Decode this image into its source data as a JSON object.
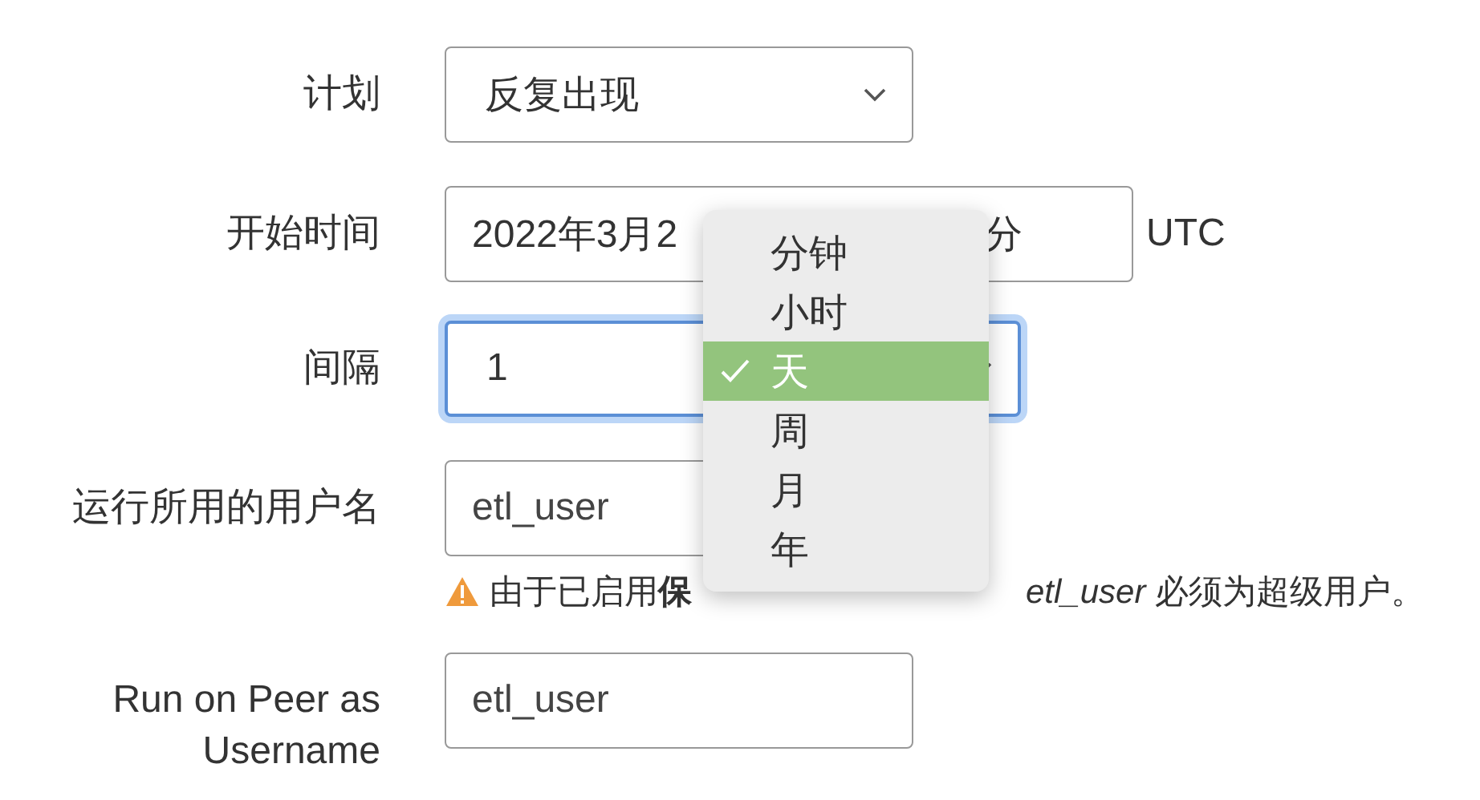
{
  "form": {
    "rows": [
      {
        "label": "计划",
        "kind": "select",
        "value": "反复出现",
        "focused": false
      },
      {
        "label": "开始时间",
        "kind": "datetime",
        "value": "2022年3月2",
        "value_end": "分",
        "suffix": "UTC"
      },
      {
        "label": "间隔",
        "kind": "select",
        "value": "1",
        "focused": true
      },
      {
        "label": "运行所用的用户名",
        "kind": "input",
        "value": "etl_user",
        "warning": {
          "before": "由于已启用**保**",
          "after": "*etl_user* 必须为超级用户。"
        }
      },
      {
        "label": "Run on Peer as Username",
        "kind": "input",
        "value": "etl_user"
      }
    ]
  },
  "dropdown": {
    "options": [
      {
        "label": "分钟",
        "selected": false
      },
      {
        "label": "小时",
        "selected": false
      },
      {
        "label": "天",
        "selected": true
      },
      {
        "label": "周",
        "selected": false
      },
      {
        "label": "月",
        "selected": false
      },
      {
        "label": "年",
        "selected": false
      }
    ]
  }
}
